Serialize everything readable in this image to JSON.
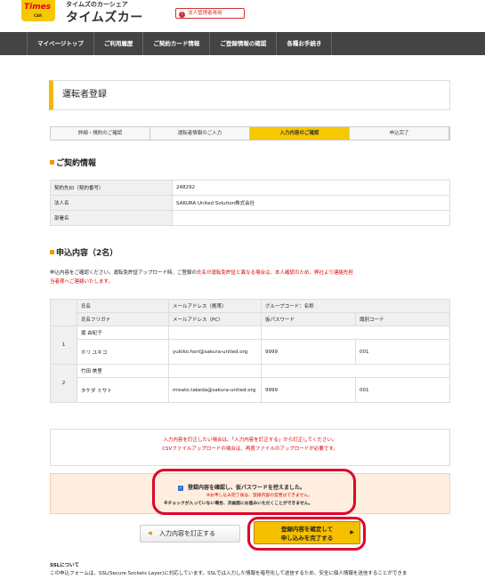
{
  "header": {
    "logo_text": "Times",
    "logo_sub": "CAR",
    "brand_sub": "タイムズのカーシェア",
    "brand_main": "タイムズカー",
    "corp_badge": "法人管理者専用",
    "corp_badge_icon": "!"
  },
  "nav": [
    "マイページトップ",
    "ご利用履歴",
    "ご契約カード情報",
    "ご登録情報の確認",
    "各種お手続き"
  ],
  "page_title": "運転者登録",
  "steps": [
    "詳細・規約のご確認",
    "運転者情報のご入力",
    "入力内容のご確認",
    "申込完了"
  ],
  "active_step": 2,
  "contract": {
    "heading": "ご契約情報",
    "rows": [
      {
        "label": "契約先ID（契約番号）",
        "value": "248292"
      },
      {
        "label": "法人名",
        "value": "SAKURA United Solution株式会社"
      },
      {
        "label": "部署名",
        "value": ""
      }
    ]
  },
  "members": {
    "heading": "申込内容（2名）",
    "notice_1": "申込内容をご確認ください。運転免許証アップロード時、ご登録の",
    "notice_red_1": "氏名が運転免許証と異なる場合は、本人確認のため、弊社より連絡先担",
    "notice_red_2": "当者様へご連絡いたします。",
    "headers_row1": [
      "氏名",
      "メールアドレス（携帯）",
      "グループコード：名称"
    ],
    "headers_row2": [
      "氏名フリガナ",
      "メールアドレス（PC）",
      "仮パスワード",
      "識別コード"
    ],
    "rows": [
      {
        "num": "1",
        "name": "堀 由紀子",
        "kana": "ホリ ユキコ",
        "mobile": "",
        "group": "",
        "email_pc": "yukiko.hori@sakura-united.org",
        "password": "9999",
        "code": "001"
      },
      {
        "num": "2",
        "name": "竹田 美里",
        "kana": "タケダ ミサト",
        "mobile": "",
        "group": "",
        "email_pc": "misato.takeda@sakura-united.org",
        "password": "9999",
        "code": "001"
      }
    ]
  },
  "error_box": {
    "line1": "入力内容を訂正したい場合は、「入力内容を訂正する」から訂正してください。",
    "line2": "CSVファイルアップロードの場合は、再度ファイルのアップロードが必要です。"
  },
  "confirm": {
    "check_mark": "✓",
    "line1": "登録内容を確認し、仮パスワードを控えました。",
    "line2": "※お申し込み完了後は、登録内容の変更はできません。",
    "line3": "※チェックが入っていない場合、次画面にお進みいただくことができません。"
  },
  "buttons": {
    "back_icon": "◀",
    "back": "入力内容を訂正する",
    "next_line1": "登録内容を確定して",
    "next_line2": "申し込みを完了する",
    "next_icon": "▶"
  },
  "ssl": {
    "heading": "SSLについて",
    "text": "この申込フォームは、SSL(Secure Sockets Layer)に対応しています。SSLでは入力した情報を暗号化して送信するため、安全に個人情報を送信することができま"
  }
}
